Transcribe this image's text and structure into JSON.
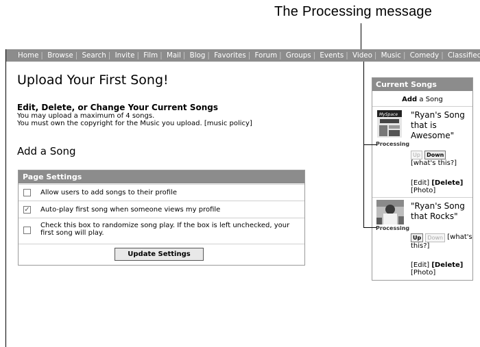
{
  "callout": {
    "text": "The Processing message"
  },
  "nav": {
    "items": [
      "Home",
      "Browse",
      "Search",
      "Invite",
      "Film",
      "Mail",
      "Blog",
      "Favorites",
      "Forum",
      "Groups",
      "Events",
      "Video",
      "Music",
      "Comedy",
      "Classifieds"
    ]
  },
  "main": {
    "title": "Upload Your First Song!",
    "subtitle": "Edit, Delete, or Change Your Current Songs",
    "line1": "You may upload a maximum of 4 songs.",
    "line2_prefix": "You must own the copyright for the Music you upload. ",
    "line2_link": "[music policy]",
    "add_song_heading": "Add a Song"
  },
  "settings": {
    "header": "Page Settings",
    "options": [
      {
        "label": "Allow users to add songs to their profile",
        "checked": false
      },
      {
        "label": "Auto-play first song when someone views my profile",
        "checked": true
      },
      {
        "label": "Check this box to randomize song play. If the box is left unchecked, your first song will play.",
        "checked": false
      }
    ],
    "update_button": "Update Settings"
  },
  "current_songs": {
    "header": "Current Songs",
    "add_bold": "Add",
    "add_rest": " a Song",
    "songs": [
      {
        "title": "\"Ryan's Song that is Awesome\"",
        "status": "Processing",
        "up": "Up",
        "down": "Down",
        "whats": "[what's this?]",
        "edit": "[Edit]",
        "delete": "[Delete]",
        "photo": "[Photo]",
        "thumb_text": "MySpace"
      },
      {
        "title": "\"Ryan's Song that Rocks\"",
        "status": "Processing",
        "up": "Up",
        "down": "Down",
        "whats": "[what's this?]",
        "edit": "[Edit]",
        "delete": "[Delete]",
        "photo": "[Photo]"
      }
    ]
  }
}
